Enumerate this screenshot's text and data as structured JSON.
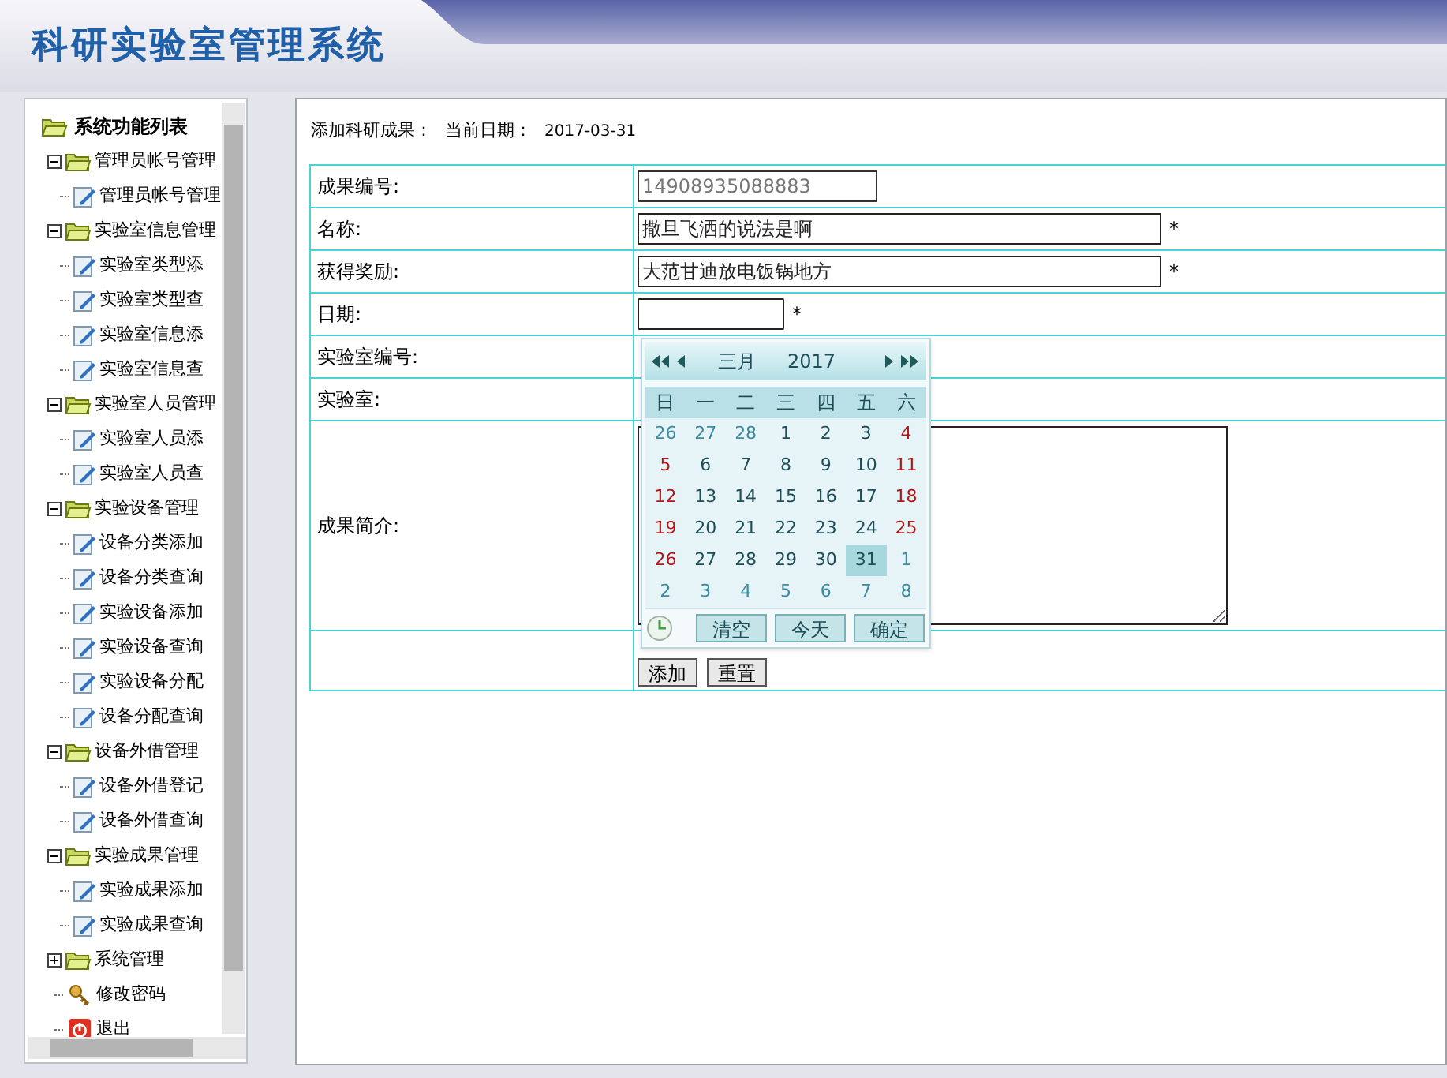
{
  "header": {
    "title": "科研实验室管理系统"
  },
  "sidebar": {
    "tree": {
      "label": "系统功能列表",
      "kind": "root",
      "children": [
        {
          "label": "管理员帐号管理",
          "kind": "group",
          "expanded": true,
          "children": [
            {
              "label": "管理员帐号管理",
              "kind": "page"
            }
          ]
        },
        {
          "label": "实验室信息管理",
          "kind": "group",
          "expanded": true,
          "children": [
            {
              "label": "实验室类型添",
              "kind": "page"
            },
            {
              "label": "实验室类型查",
              "kind": "page"
            },
            {
              "label": "实验室信息添",
              "kind": "page"
            },
            {
              "label": "实验室信息查",
              "kind": "page"
            }
          ]
        },
        {
          "label": "实验室人员管理",
          "kind": "group",
          "expanded": true,
          "children": [
            {
              "label": "实验室人员添",
              "kind": "page"
            },
            {
              "label": "实验室人员查",
              "kind": "page"
            }
          ]
        },
        {
          "label": "实验设备管理",
          "kind": "group",
          "expanded": true,
          "children": [
            {
              "label": "设备分类添加",
              "kind": "page"
            },
            {
              "label": "设备分类查询",
              "kind": "page"
            },
            {
              "label": "实验设备添加",
              "kind": "page"
            },
            {
              "label": "实验设备查询",
              "kind": "page"
            },
            {
              "label": "实验设备分配",
              "kind": "page"
            },
            {
              "label": "设备分配查询",
              "kind": "page"
            }
          ]
        },
        {
          "label": "设备外借管理",
          "kind": "group",
          "expanded": true,
          "children": [
            {
              "label": "设备外借登记",
              "kind": "page"
            },
            {
              "label": "设备外借查询",
              "kind": "page"
            }
          ]
        },
        {
          "label": "实验成果管理",
          "kind": "group",
          "expanded": true,
          "children": [
            {
              "label": "实验成果添加",
              "kind": "page"
            },
            {
              "label": "实验成果查询",
              "kind": "page"
            }
          ]
        },
        {
          "label": "系统管理",
          "kind": "group",
          "expanded": false
        },
        {
          "label": "修改密码",
          "kind": "password"
        },
        {
          "label": "退出",
          "kind": "exit"
        }
      ]
    }
  },
  "page": {
    "heading": "添加科研成果：",
    "date_label": "当前日期：",
    "date": "2017-03-31"
  },
  "form": {
    "rows": [
      {
        "label": "成果编号:",
        "kind": "text",
        "value": "14908935088883",
        "readonly": true
      },
      {
        "label": "名称:",
        "kind": "text",
        "value": "撒旦飞洒的说法是啊",
        "readonly": false,
        "marker": "*"
      },
      {
        "label": "获得奖励:",
        "kind": "text",
        "value": "大范甘迪放电饭锅地方",
        "readonly": false,
        "marker": "*"
      },
      {
        "label": "日期:",
        "kind": "date",
        "value": "",
        "readonly": false,
        "marker": "*"
      },
      {
        "label": "实验室编号:",
        "kind": "blank"
      },
      {
        "label": "实验室:",
        "kind": "blank"
      },
      {
        "label": "成果简介:",
        "kind": "textarea"
      }
    ],
    "buttons": [
      "添加",
      "重置"
    ]
  },
  "calendar": {
    "month": "三月",
    "year": "2017",
    "weekdays": [
      "日",
      "一",
      "二",
      "三",
      "四",
      "五",
      "六"
    ],
    "days": [
      {
        "text": "26",
        "kind": "other",
        "selected": false
      },
      {
        "text": "27",
        "kind": "other",
        "selected": false
      },
      {
        "text": "28",
        "kind": "other",
        "selected": false
      },
      {
        "text": "1",
        "kind": "day",
        "selected": false
      },
      {
        "text": "2",
        "kind": "day",
        "selected": false
      },
      {
        "text": "3",
        "kind": "day",
        "selected": false
      },
      {
        "text": "4",
        "kind": "weekend",
        "selected": false
      },
      {
        "text": "5",
        "kind": "weekend",
        "selected": false
      },
      {
        "text": "6",
        "kind": "day",
        "selected": false
      },
      {
        "text": "7",
        "kind": "day",
        "selected": false
      },
      {
        "text": "8",
        "kind": "day",
        "selected": false
      },
      {
        "text": "9",
        "kind": "day",
        "selected": false
      },
      {
        "text": "10",
        "kind": "day",
        "selected": false
      },
      {
        "text": "11",
        "kind": "weekend",
        "selected": false
      },
      {
        "text": "12",
        "kind": "weekend",
        "selected": false
      },
      {
        "text": "13",
        "kind": "day",
        "selected": false
      },
      {
        "text": "14",
        "kind": "day",
        "selected": false
      },
      {
        "text": "15",
        "kind": "day",
        "selected": false
      },
      {
        "text": "16",
        "kind": "day",
        "selected": false
      },
      {
        "text": "17",
        "kind": "day",
        "selected": false
      },
      {
        "text": "18",
        "kind": "weekend",
        "selected": false
      },
      {
        "text": "19",
        "kind": "weekend",
        "selected": false
      },
      {
        "text": "20",
        "kind": "day",
        "selected": false
      },
      {
        "text": "21",
        "kind": "day",
        "selected": false
      },
      {
        "text": "22",
        "kind": "day",
        "selected": false
      },
      {
        "text": "23",
        "kind": "day",
        "selected": false
      },
      {
        "text": "24",
        "kind": "day",
        "selected": false
      },
      {
        "text": "25",
        "kind": "weekend",
        "selected": false
      },
      {
        "text": "26",
        "kind": "weekend",
        "selected": false
      },
      {
        "text": "27",
        "kind": "day",
        "selected": false
      },
      {
        "text": "28",
        "kind": "day",
        "selected": false
      },
      {
        "text": "29",
        "kind": "day",
        "selected": false
      },
      {
        "text": "30",
        "kind": "day",
        "selected": false
      },
      {
        "text": "31",
        "kind": "day",
        "selected": true
      },
      {
        "text": "1",
        "kind": "other",
        "selected": false
      },
      {
        "text": "2",
        "kind": "other",
        "selected": false
      },
      {
        "text": "3",
        "kind": "other",
        "selected": false
      },
      {
        "text": "4",
        "kind": "other",
        "selected": false
      },
      {
        "text": "5",
        "kind": "other",
        "selected": false
      },
      {
        "text": "6",
        "kind": "other",
        "selected": false
      },
      {
        "text": "7",
        "kind": "other",
        "selected": false
      },
      {
        "text": "8",
        "kind": "other",
        "selected": false
      }
    ],
    "buttons": [
      "清空",
      "今天",
      "确定"
    ]
  }
}
